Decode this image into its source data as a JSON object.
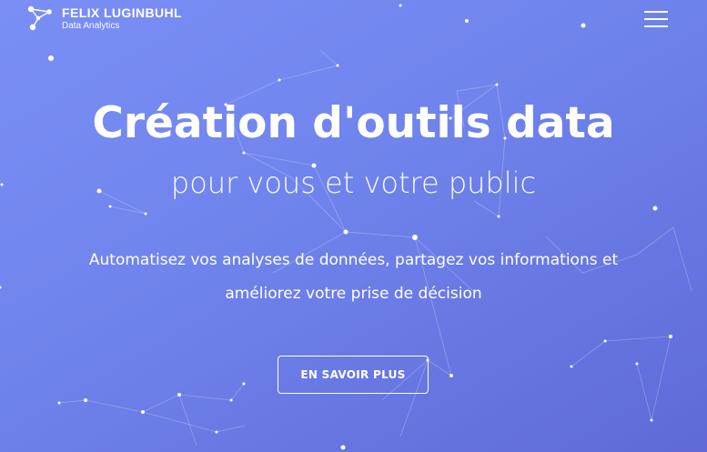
{
  "header": {
    "brand_name": "FELIX LUGINBUHL",
    "brand_subtitle": "Data Analytics",
    "logo_icon": "network-graph-icon",
    "menu_icon": "hamburger-menu-icon"
  },
  "hero": {
    "title": "Création d'outils data",
    "subtitle": "pour vous et votre public",
    "description_line1": "Automatisez vos analyses de données, partagez vos informations et",
    "description_line2": "améliorez votre prise de décision",
    "cta_label": "EN SAVOIR PLUS"
  },
  "colors": {
    "gradient_start": "#7a8ff6",
    "gradient_end": "#5f6ad8",
    "text": "#ffffff"
  }
}
